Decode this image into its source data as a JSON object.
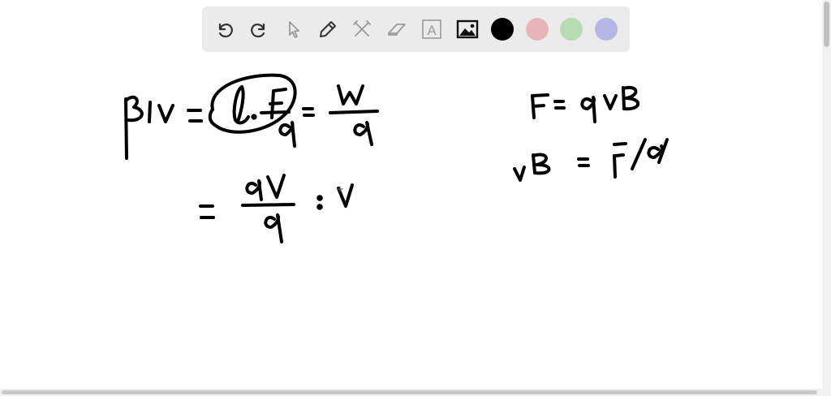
{
  "toolbar": {
    "tools": [
      {
        "icon": "undo-icon"
      },
      {
        "icon": "redo-icon"
      },
      {
        "icon": "select-pointer-icon"
      },
      {
        "icon": "pen-icon"
      },
      {
        "icon": "tools-icon"
      },
      {
        "icon": "eraser-icon"
      },
      {
        "icon": "text-box-icon",
        "glyph": "A"
      },
      {
        "icon": "image-icon"
      }
    ],
    "colors": [
      {
        "name": "black",
        "hex": "#000000"
      },
      {
        "name": "red",
        "hex": "#e8b4b8"
      },
      {
        "name": "green",
        "hex": "#b9dbb4"
      },
      {
        "name": "blue",
        "hex": "#b7b5e8"
      }
    ]
  },
  "canvas": {
    "ink_color": "#000000"
  }
}
